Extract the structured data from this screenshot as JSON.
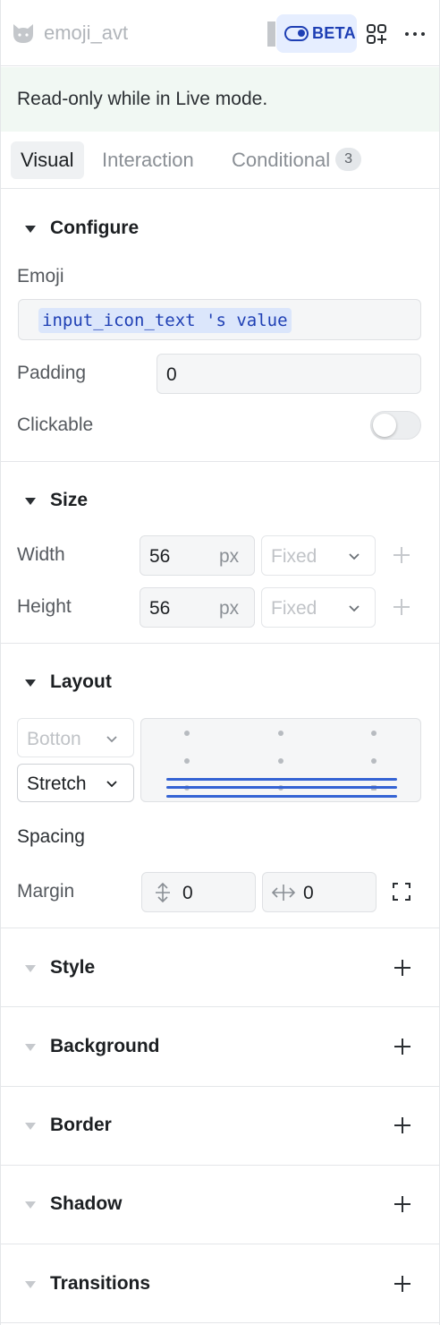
{
  "header": {
    "component_name": "emoji_avt",
    "beta_label": "BETA"
  },
  "notice": {
    "text": "Read-only while in Live mode."
  },
  "tabs": [
    {
      "label": "Visual",
      "active": true
    },
    {
      "label": "Interaction",
      "active": false
    },
    {
      "label": "Conditional",
      "active": false,
      "badge": "3"
    }
  ],
  "configure": {
    "title": "Configure",
    "emoji_label": "Emoji",
    "emoji_binding": "input_icon_text 's value",
    "padding_label": "Padding",
    "padding_value": "0",
    "clickable_label": "Clickable",
    "clickable_on": false
  },
  "size": {
    "title": "Size",
    "width_label": "Width",
    "width_value": "56",
    "width_unit": "px",
    "width_mode": "Fixed",
    "height_label": "Height",
    "height_value": "56",
    "height_unit": "px",
    "height_mode": "Fixed"
  },
  "layout": {
    "title": "Layout",
    "vertical_align": "Botton",
    "horizontal_align": "Stretch",
    "spacing_label": "Spacing",
    "margin_label": "Margin",
    "margin_vertical": "0",
    "margin_horizontal": "0"
  },
  "collapsed_sections": [
    {
      "title": "Style"
    },
    {
      "title": "Background"
    },
    {
      "title": "Border"
    },
    {
      "title": "Shadow"
    },
    {
      "title": "Transitions"
    }
  ],
  "colors": {
    "accent": "#1e3fb4",
    "notice_bg": "#f1f8f3",
    "align_bars": "#3463d4"
  }
}
